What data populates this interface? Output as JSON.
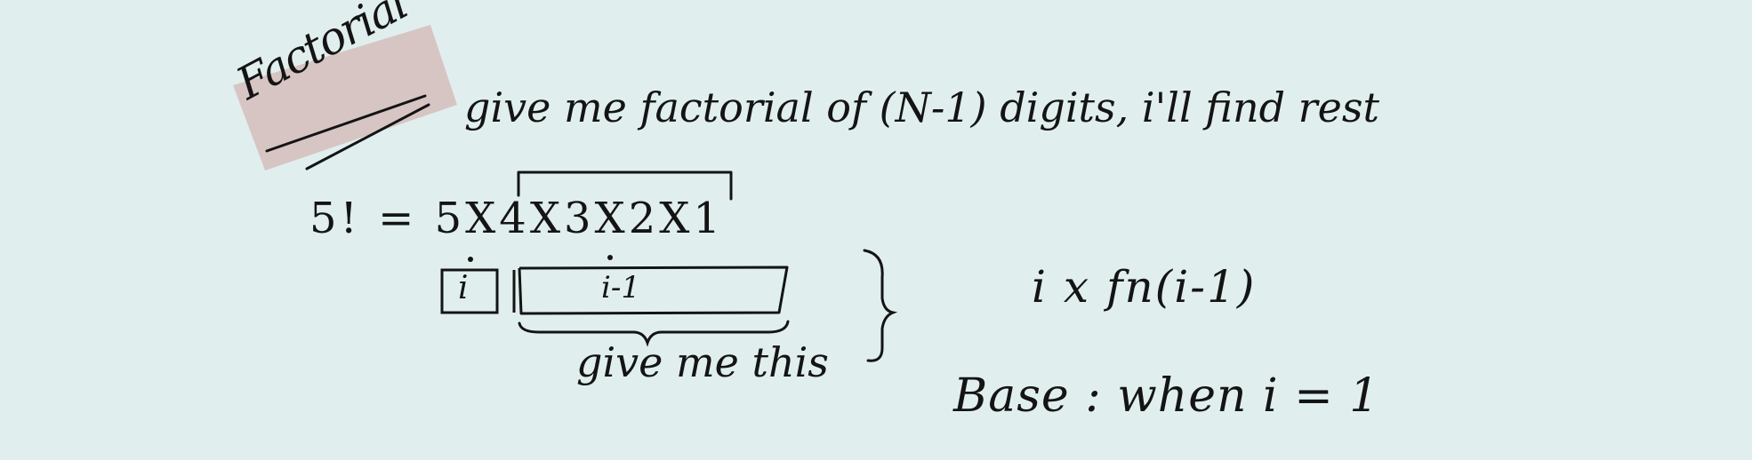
{
  "note": {
    "title": "Factorial",
    "subtitle": "give me factorial of (N-1) digits, i'll find rest",
    "equation": "5! = 5X4X3X2X1",
    "box_i_label": "i",
    "box_rest_label": "i-1",
    "brace_caption": "give me this",
    "recurrence": "i x fn(i-1)",
    "base_case": "Base : when i = 1"
  },
  "colors": {
    "background": "#e0efee",
    "ink": "#141414",
    "highlight": "#d4b7b5"
  }
}
